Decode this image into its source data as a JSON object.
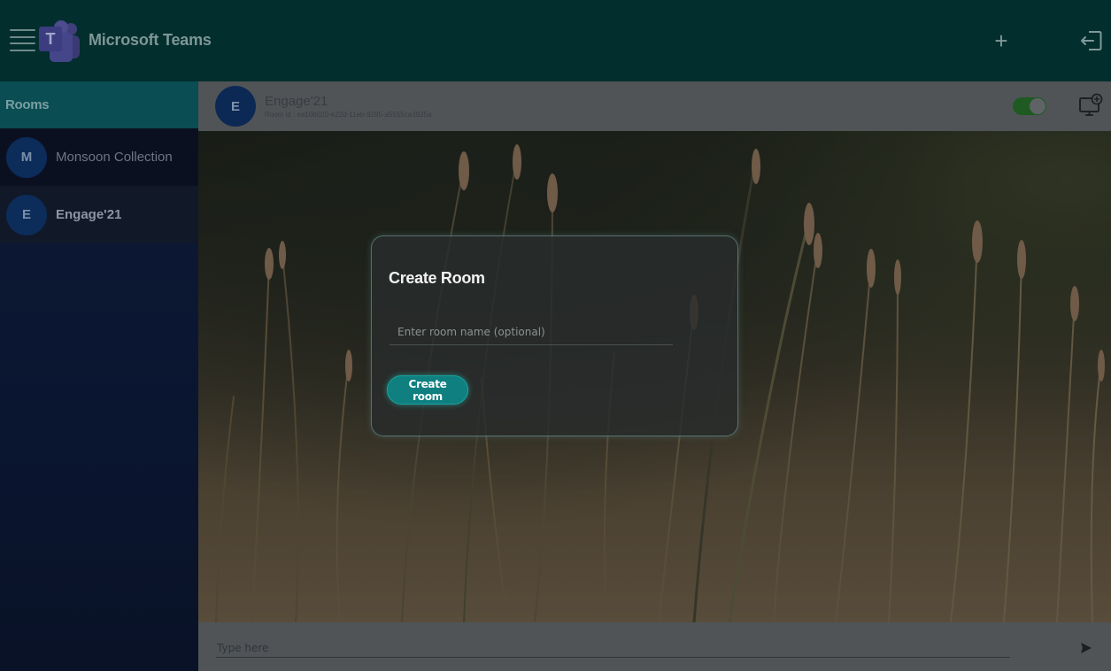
{
  "header": {
    "app_title": "Microsoft Teams",
    "logo_letter": "T",
    "menu_icon": "hamburger-menu-icon",
    "add_icon": "plus-icon",
    "add_symbol": "+",
    "logout_icon": "logout-icon"
  },
  "sidebar": {
    "heading": "Rooms",
    "rooms": [
      {
        "initial": "M",
        "name": "Monsoon Collection"
      },
      {
        "initial": "E",
        "name": "Engage'21"
      }
    ],
    "active_index": 1
  },
  "room_header": {
    "initial": "E",
    "name": "Engage'21",
    "room_id": "Room id : ea10b020-e22d-11eb-9295-a5555ca3925a",
    "toggle_on": true,
    "screen_share_icon": "screen-share-icon"
  },
  "modal": {
    "title": "Create Room",
    "input_placeholder": "Enter room name (optional)",
    "input_value": "",
    "button_label": "Create room"
  },
  "chat": {
    "placeholder": "Type here",
    "send_icon": "send-icon"
  },
  "colors": {
    "header_bg": "#022e2d",
    "sidebar_heading_bg": "#0a4d52",
    "accent": "#0f7f80",
    "toggle_on": "#1e5a22"
  }
}
